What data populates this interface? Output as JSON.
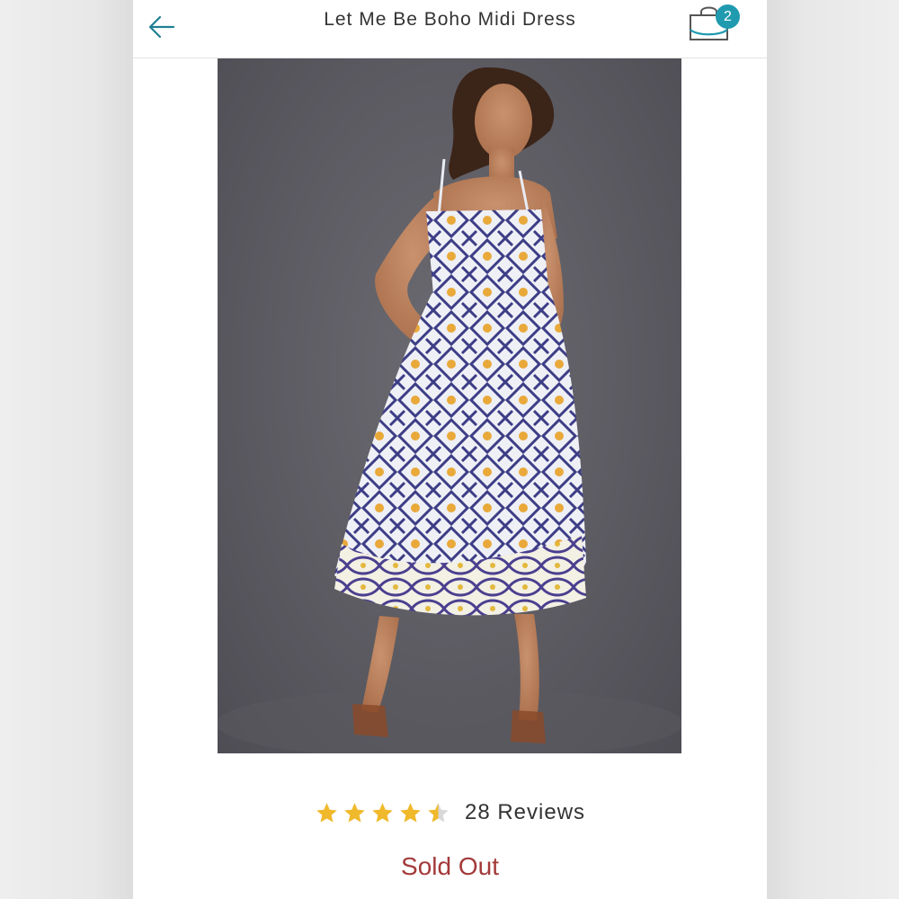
{
  "header": {
    "title": "Let Me Be Boho Midi Dress",
    "back_icon": "arrow-left-icon",
    "cart_icon": "shopping-bag-icon",
    "cart_count": "2",
    "accent_color": "#1f9aae"
  },
  "product": {
    "image_alt": "Model wearing a boho print midi dress",
    "rating": 4.5,
    "rating_max": 5,
    "reviews_label": "28 Reviews",
    "status": "Sold Out",
    "status_color": "#a33a3a",
    "star_color": "#f0b92b"
  }
}
